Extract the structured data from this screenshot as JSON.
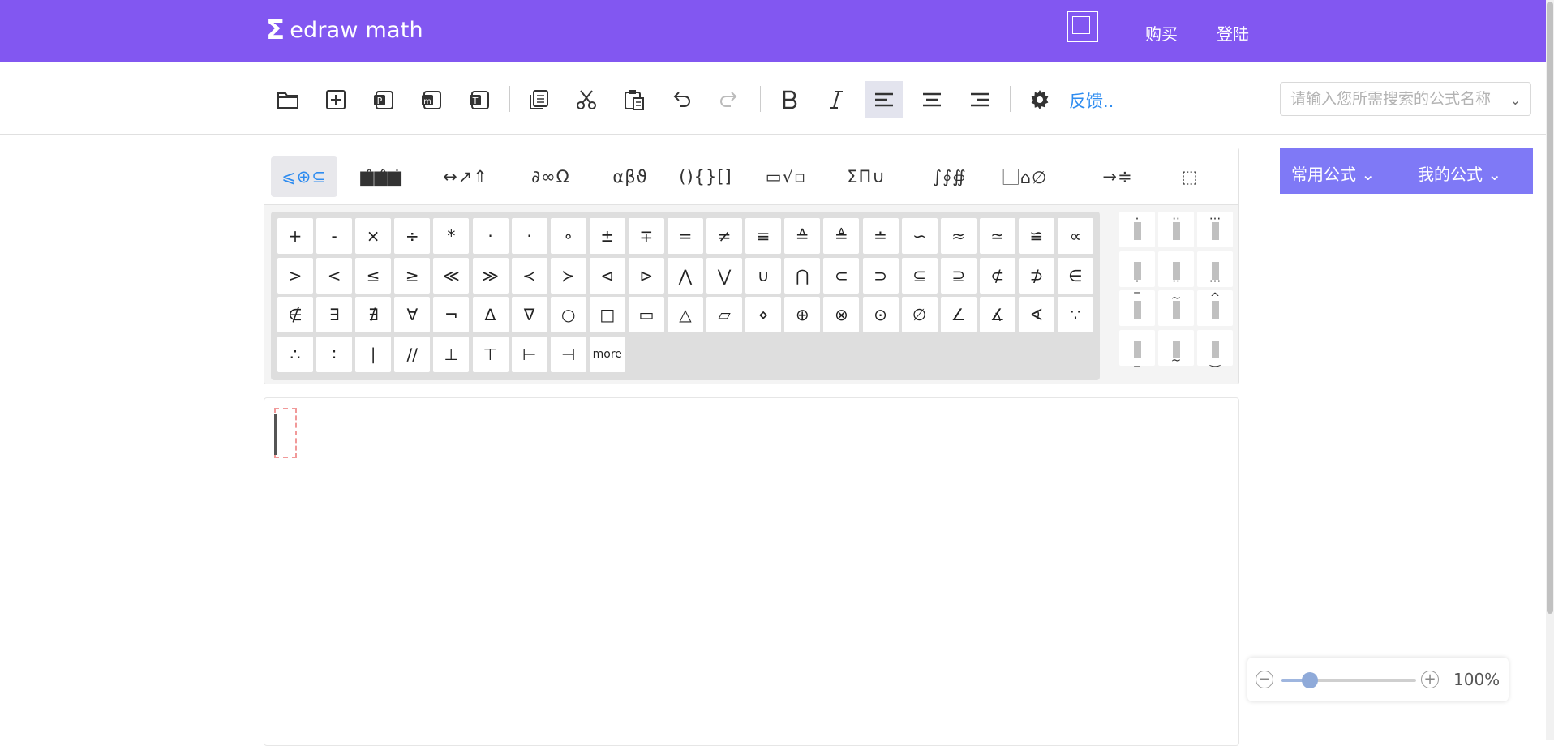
{
  "header": {
    "logo_text": "edraw math",
    "buy_label": "购买",
    "login_label": "登陆"
  },
  "toolbar": {
    "icons": [
      "open-folder-icon",
      "new-file-icon",
      "export-p-icon",
      "export-m-icon",
      "export-t-icon",
      "copy-icon",
      "cut-icon",
      "paste-icon",
      "undo-icon",
      "redo-icon",
      "bold-icon",
      "italic-icon",
      "align-left-icon",
      "align-center-icon",
      "align-right-icon",
      "settings-gear-icon"
    ],
    "feedback_label": "反馈..",
    "search_placeholder": "请输入您所需搜索的公式名称"
  },
  "symbol_tabs": [
    "⩽⊕⊆",
    "▆̂▆̂▆̇",
    "↔↗⇑",
    "∂∞Ω",
    "αβϑ",
    "(){}[]",
    "▭√▫",
    "ΣΠ∪",
    "∫∮∯",
    "⃞⌂∅",
    "→≑",
    "⬚"
  ],
  "symbols": [
    [
      "+",
      "-",
      "×",
      "÷",
      "*",
      "·",
      "·",
      "∘",
      "±",
      "∓",
      "=",
      "≠",
      "≡",
      "≙",
      "≜",
      "≐",
      "∽",
      "≈",
      "≃",
      "≌",
      "∝"
    ],
    [
      ">",
      "<",
      "≤",
      "≥",
      "≪",
      "≫",
      "≺",
      "≻",
      "⊲",
      "⊳",
      "⋀",
      "⋁",
      "∪",
      "⋂",
      "⊂",
      "⊃",
      "⊆",
      "⊇",
      "⊄",
      "⊅",
      "∈"
    ],
    [
      "∉",
      "∃",
      "∄",
      "∀",
      "¬",
      "∆",
      "∇",
      "○",
      "□",
      "▭",
      "△",
      "▱",
      "⋄",
      "⊕",
      "⊗",
      "⊙",
      "∅",
      "∠",
      "∡",
      "∢",
      "∵"
    ],
    [
      "∴",
      "∶",
      "∣",
      "∕∕",
      "⊥",
      "⊤",
      "⊢",
      "⊣",
      "more"
    ]
  ],
  "accents": [
    {
      "mark": "·",
      "pos": "top"
    },
    {
      "mark": "··",
      "pos": "top"
    },
    {
      "mark": "···",
      "pos": "top"
    },
    {
      "mark": "·",
      "pos": "bottom"
    },
    {
      "mark": "··",
      "pos": "bottom"
    },
    {
      "mark": "···",
      "pos": "bottom"
    },
    {
      "mark": "‾",
      "pos": "top"
    },
    {
      "mark": "~",
      "pos": "top"
    },
    {
      "mark": "^",
      "pos": "top"
    },
    {
      "mark": "_",
      "pos": "bottom"
    },
    {
      "mark": "~",
      "pos": "bottom"
    },
    {
      "mark": "‿",
      "pos": "bottom"
    }
  ],
  "formula_panel": {
    "common_label": "常用公式",
    "mine_label": "我的公式"
  },
  "zoom": {
    "value_label": "100%",
    "level_fraction": 0.15
  },
  "colors": {
    "header": "#8257f1",
    "accent": "#2e8cf0",
    "formula_bar": "#7f79f6"
  }
}
